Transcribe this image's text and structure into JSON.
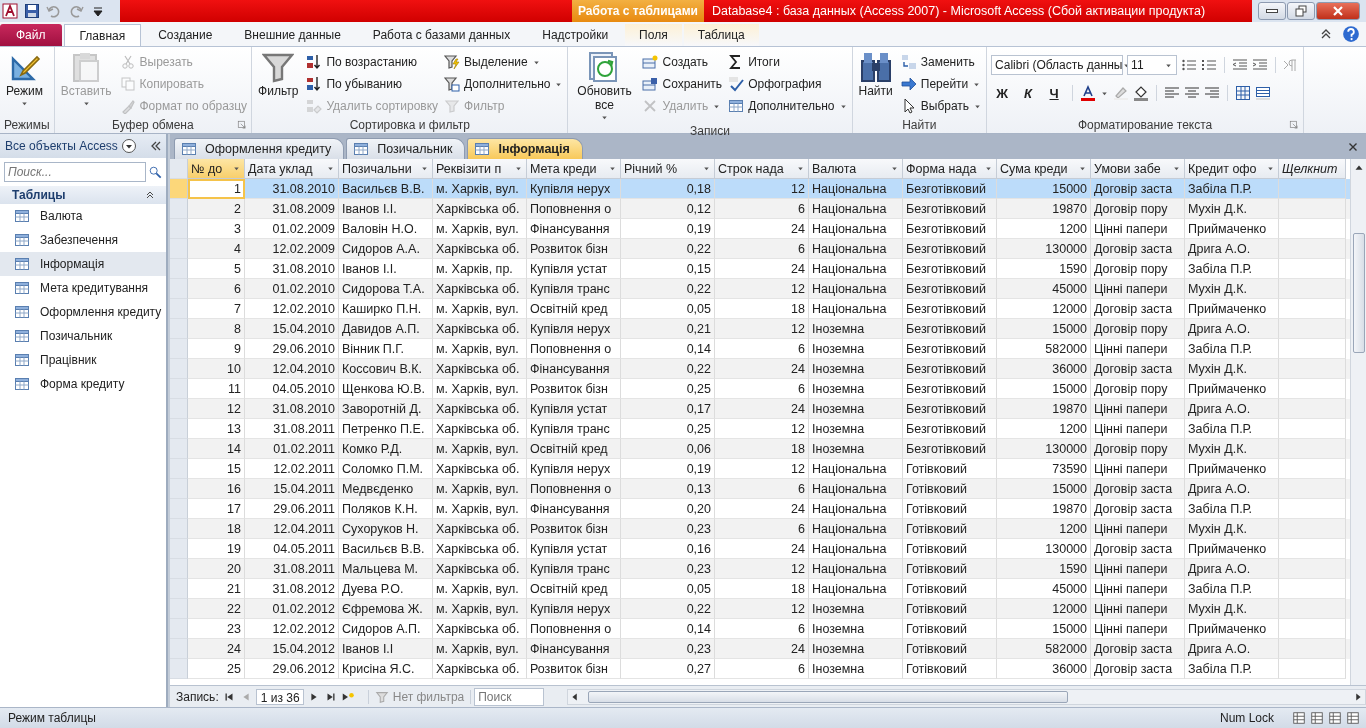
{
  "window": {
    "title": "Database4 : база данных (Access 2007)  -  Microsoft Access (Сбой активации продукта)",
    "context_label": "Работа с таблицами"
  },
  "ribbon_tabs": [
    {
      "label": "Файл",
      "kind": "file",
      "selected": false
    },
    {
      "label": "Главная",
      "kind": "tab",
      "selected": true
    },
    {
      "label": "Создание",
      "kind": "tab",
      "selected": false
    },
    {
      "label": "Внешние данные",
      "kind": "tab",
      "selected": false
    },
    {
      "label": "Работа с базами данных",
      "kind": "tab",
      "selected": false
    },
    {
      "label": "Надстройки",
      "kind": "tab",
      "selected": false
    },
    {
      "label": "Поля",
      "kind": "context",
      "selected": false
    },
    {
      "label": "Таблица",
      "kind": "context",
      "selected": false
    }
  ],
  "ribbon": {
    "groups": [
      {
        "label": "Режимы",
        "kind": "commands",
        "launcher": false,
        "items": [
          {
            "label": "Режим",
            "kind": "large",
            "dropdown": true,
            "disabled": false
          }
        ]
      },
      {
        "label": "Буфер обмена",
        "kind": "commands",
        "launcher": true,
        "items": [
          {
            "label": "Вставить",
            "kind": "large",
            "dropdown": true,
            "disabled": true
          },
          {
            "label": "Вырезать",
            "kind": "small",
            "dropdown": false,
            "disabled": true
          },
          {
            "label": "Копировать",
            "kind": "small",
            "dropdown": false,
            "disabled": true
          },
          {
            "label": "Формат по образцу",
            "kind": "small",
            "dropdown": false,
            "disabled": true
          }
        ]
      },
      {
        "label": "Сортировка и фильтр",
        "kind": "commands",
        "launcher": false,
        "items": [
          {
            "label": "Фильтр",
            "kind": "large",
            "dropdown": false,
            "disabled": false
          },
          {
            "label": "По возрастанию",
            "kind": "small",
            "dropdown": false,
            "disabled": false
          },
          {
            "label": "По убыванию",
            "kind": "small",
            "dropdown": false,
            "disabled": false
          },
          {
            "label": "Удалить сортировку",
            "kind": "small",
            "dropdown": false,
            "disabled": true
          },
          {
            "label": "Выделение",
            "kind": "small",
            "dropdown": true,
            "disabled": false
          },
          {
            "label": "Дополнительно",
            "kind": "small",
            "dropdown": true,
            "disabled": false
          },
          {
            "label": "Фильтр",
            "kind": "small",
            "dropdown": false,
            "disabled": true
          }
        ]
      },
      {
        "label": "Записи",
        "kind": "commands",
        "launcher": false,
        "items": [
          {
            "label": "Обновить все",
            "kind": "large",
            "dropdown": true,
            "disabled": false
          },
          {
            "label": "Создать",
            "kind": "small",
            "dropdown": false,
            "disabled": false
          },
          {
            "label": "Сохранить",
            "kind": "small",
            "dropdown": false,
            "disabled": false
          },
          {
            "label": "Удалить",
            "kind": "small",
            "dropdown": true,
            "disabled": true
          },
          {
            "label": "Итоги",
            "kind": "small",
            "dropdown": false,
            "disabled": false
          },
          {
            "label": "Орфография",
            "kind": "small",
            "dropdown": false,
            "disabled": false
          },
          {
            "label": "Дополнительно",
            "kind": "small",
            "dropdown": true,
            "disabled": false
          }
        ]
      },
      {
        "label": "Найти",
        "kind": "commands",
        "launcher": false,
        "items": [
          {
            "label": "Найти",
            "kind": "large",
            "dropdown": false,
            "disabled": false
          },
          {
            "label": "Заменить",
            "kind": "small",
            "dropdown": false,
            "disabled": false
          },
          {
            "label": "Перейти",
            "kind": "small",
            "dropdown": true,
            "disabled": false
          },
          {
            "label": "Выбрать",
            "kind": "small",
            "dropdown": true,
            "disabled": false
          }
        ]
      },
      {
        "label": "Форматирование текста",
        "kind": "formatting",
        "launcher": true,
        "font": "Calibri (Область данны",
        "font_size": "11",
        "style_buttons": [
          "Ж",
          "К",
          "Ч"
        ]
      }
    ]
  },
  "navigation": {
    "title": "Все объекты Access",
    "search": {
      "placeholder": "Поиск..."
    },
    "section": "Таблицы",
    "items": [
      {
        "label": "Валюта",
        "selected": false
      },
      {
        "label": "Забезпечення",
        "selected": false
      },
      {
        "label": "Інформація",
        "selected": true
      },
      {
        "label": "Мета кредитування",
        "selected": false
      },
      {
        "label": "Оформлення кредиту",
        "selected": false
      },
      {
        "label": "Позичальник",
        "selected": false
      },
      {
        "label": "Працівник",
        "selected": false
      },
      {
        "label": "Форма кредиту",
        "selected": false
      }
    ]
  },
  "document_tabs": [
    {
      "label": "Оформлення кредиту",
      "selected": false
    },
    {
      "label": "Позичальник",
      "selected": false
    },
    {
      "label": "Інформація",
      "selected": true
    }
  ],
  "table": {
    "columns": [
      {
        "label": "№ до",
        "kind": "field"
      },
      {
        "label": "Дата уклад",
        "kind": "field"
      },
      {
        "label": "Позичальни",
        "kind": "field"
      },
      {
        "label": "Реквізити п",
        "kind": "field"
      },
      {
        "label": "Мета креди",
        "kind": "field"
      },
      {
        "label": "Річний %",
        "kind": "field"
      },
      {
        "label": "Строк нада",
        "kind": "field"
      },
      {
        "label": "Валюта",
        "kind": "field"
      },
      {
        "label": "Форма нада",
        "kind": "field"
      },
      {
        "label": "Сума креди",
        "kind": "field"
      },
      {
        "label": "Умови забе",
        "kind": "field"
      },
      {
        "label": "Кредит офо",
        "kind": "field"
      },
      {
        "label": "Щелкнит",
        "kind": "add"
      }
    ],
    "rows": [
      {
        "selected": true,
        "cells": [
          "1",
          "31.08.2010",
          "Васильєв В.В.",
          "м. Харків, вул.",
          "Купівля нерух",
          "0,18",
          "12",
          "Національна",
          "Безготівковий",
          "15000",
          "Договір заста",
          "Забіла П.Р."
        ]
      },
      {
        "selected": false,
        "cells": [
          "2",
          "31.08.2009",
          "Іванов І.І.",
          "Харківська об.",
          "Поповнення о",
          "0,12",
          "6",
          "Національна",
          "Безготівковий",
          "19870",
          "Договір пору",
          "Мухін Д.К."
        ]
      },
      {
        "selected": false,
        "cells": [
          "3",
          "01.02.2009",
          "Валовін Н.О.",
          "м. Харків, вул.",
          "Фінансування",
          "0,19",
          "24",
          "Національна",
          "Безготівковий",
          "1200",
          "Цінні папери",
          "Приймаченко"
        ]
      },
      {
        "selected": false,
        "cells": [
          "4",
          "12.02.2009",
          "Сидоров А.А.",
          "Харківська об.",
          "Розвиток бізн",
          "0,22",
          "6",
          "Національна",
          "Безготівковий",
          "130000",
          "Договір заста",
          "Дрига А.О."
        ]
      },
      {
        "selected": false,
        "cells": [
          "5",
          "31.08.2010",
          "Іванов І.І.",
          "м. Харків, пр.",
          "Купівля устат",
          "0,15",
          "24",
          "Національна",
          "Безготівковий",
          "1590",
          "Договір пору",
          "Забіла П.Р."
        ]
      },
      {
        "selected": false,
        "cells": [
          "6",
          "01.02.2010",
          "Сидорова Т.А.",
          "Харківська об.",
          "Купівля транс",
          "0,22",
          "12",
          "Національна",
          "Безготівковий",
          "45000",
          "Цінні папери",
          "Мухін Д.К."
        ]
      },
      {
        "selected": false,
        "cells": [
          "7",
          "12.02.2010",
          "Каширко П.Н.",
          "м. Харків, вул.",
          "Освітній кред",
          "0,05",
          "18",
          "Національна",
          "Безготівковий",
          "12000",
          "Договір заста",
          "Приймаченко"
        ]
      },
      {
        "selected": false,
        "cells": [
          "8",
          "15.04.2010",
          "Давидов А.П.",
          "Харківська об.",
          "Купівля нерух",
          "0,21",
          "12",
          "Іноземна",
          "Безготівковий",
          "15000",
          "Договір пору",
          "Дрига А.О."
        ]
      },
      {
        "selected": false,
        "cells": [
          "9",
          "29.06.2010",
          "Вінник П.Г.",
          "м. Харків, вул.",
          "Поповнення о",
          "0,14",
          "6",
          "Іноземна",
          "Безготівковий",
          "582000",
          "Цінні папери",
          "Забіла П.Р."
        ]
      },
      {
        "selected": false,
        "cells": [
          "10",
          "12.04.2010",
          "Коссович В.К.",
          "Харківська об.",
          "Фінансування",
          "0,22",
          "24",
          "Іноземна",
          "Безготівковий",
          "36000",
          "Договір заста",
          "Мухін Д.К."
        ]
      },
      {
        "selected": false,
        "cells": [
          "11",
          "04.05.2010",
          "Щенкова Ю.В.",
          "м. Харків, вул.",
          "Розвиток бізн",
          "0,25",
          "6",
          "Іноземна",
          "Безготівковий",
          "15000",
          "Договір пору",
          "Приймаченко"
        ]
      },
      {
        "selected": false,
        "cells": [
          "12",
          "31.08.2010",
          "Заворотній Д.",
          "Харківська об.",
          "Купівля устат",
          "0,17",
          "24",
          "Іноземна",
          "Безготівковий",
          "19870",
          "Цінні папери",
          "Дрига А.О."
        ]
      },
      {
        "selected": false,
        "cells": [
          "13",
          "31.08.2011",
          "Петренко П.Е.",
          "Харківська об.",
          "Купівля транс",
          "0,25",
          "12",
          "Іноземна",
          "Безготівковий",
          "1200",
          "Цінні папери",
          "Забіла П.Р."
        ]
      },
      {
        "selected": false,
        "cells": [
          "14",
          "01.02.2011",
          "Комко Р.Д.",
          "м. Харків, вул.",
          "Освітній кред",
          "0,06",
          "18",
          "Іноземна",
          "Безготівковий",
          "130000",
          "Договір пору",
          "Мухін Д.К."
        ]
      },
      {
        "selected": false,
        "cells": [
          "15",
          "12.02.2011",
          "Соломко П.М.",
          "Харківська об.",
          "Купівля нерух",
          "0,19",
          "12",
          "Національна",
          "Готівковий",
          "73590",
          "Цінні папери",
          "Приймаченко"
        ]
      },
      {
        "selected": false,
        "cells": [
          "16",
          "15.04.2011",
          "Медвєденко",
          "м. Харків, вул.",
          "Поповнення о",
          "0,13",
          "6",
          "Національна",
          "Готівковий",
          "15000",
          "Договір заста",
          "Дрига А.О."
        ]
      },
      {
        "selected": false,
        "cells": [
          "17",
          "29.06.2011",
          "Поляков К.Н.",
          "м. Харків, вул.",
          "Фінансування",
          "0,20",
          "24",
          "Національна",
          "Готівковий",
          "19870",
          "Договір заста",
          "Забіла П.Р."
        ]
      },
      {
        "selected": false,
        "cells": [
          "18",
          "12.04.2011",
          "Сухоруков Н.",
          "Харківська об.",
          "Розвиток бізн",
          "0,23",
          "6",
          "Національна",
          "Готівковий",
          "1200",
          "Цінні папери",
          "Мухін Д.К."
        ]
      },
      {
        "selected": false,
        "cells": [
          "19",
          "04.05.2011",
          "Васильєв В.В.",
          "Харківська об.",
          "Купівля устат",
          "0,16",
          "24",
          "Національна",
          "Готівковий",
          "130000",
          "Договір заста",
          "Приймаченко"
        ]
      },
      {
        "selected": false,
        "cells": [
          "20",
          "31.08.2011",
          "Мальцева М.",
          "Харківська об.",
          "Купівля транс",
          "0,23",
          "12",
          "Національна",
          "Готівковий",
          "1590",
          "Цінні папери",
          "Дрига А.О."
        ]
      },
      {
        "selected": false,
        "cells": [
          "21",
          "31.08.2012",
          "Дуева Р.О.",
          "м. Харків, вул.",
          "Освітній кред",
          "0,05",
          "18",
          "Національна",
          "Готівковий",
          "45000",
          "Цінні папери",
          "Забіла П.Р."
        ]
      },
      {
        "selected": false,
        "cells": [
          "22",
          "01.02.2012",
          "Єфремова Ж.",
          "м. Харків, вул.",
          "Купівля нерух",
          "0,22",
          "12",
          "Іноземна",
          "Готівковий",
          "12000",
          "Цінні папери",
          "Мухін Д.К."
        ]
      },
      {
        "selected": false,
        "cells": [
          "23",
          "12.02.2012",
          "Сидоров А.П.",
          "Харківська об.",
          "Поповнення о",
          "0,14",
          "6",
          "Іноземна",
          "Готівковий",
          "15000",
          "Цінні папери",
          "Приймаченко"
        ]
      },
      {
        "selected": false,
        "cells": [
          "24",
          "15.04.2012",
          "Іванов І.І",
          "м. Харків, вул.",
          "Фінансування",
          "0,23",
          "24",
          "Іноземна",
          "Готівковий",
          "582000",
          "Договір заста",
          "Дрига А.О."
        ]
      },
      {
        "selected": false,
        "cells": [
          "25",
          "29.06.2012",
          "Крисіна Я.С.",
          "Харківська об.",
          "Розвиток бізн",
          "0,27",
          "6",
          "Іноземна",
          "Готівковий",
          "36000",
          "Договір заста",
          "Забіла П.Р."
        ]
      }
    ]
  },
  "record_nav": {
    "label": "Запись:",
    "position": "1 из 36",
    "filter": "Нет фильтра",
    "search": {
      "placeholder": "Поиск"
    }
  },
  "status_bar": {
    "mode": "Режим таблицы",
    "num_lock": "Num Lock"
  }
}
